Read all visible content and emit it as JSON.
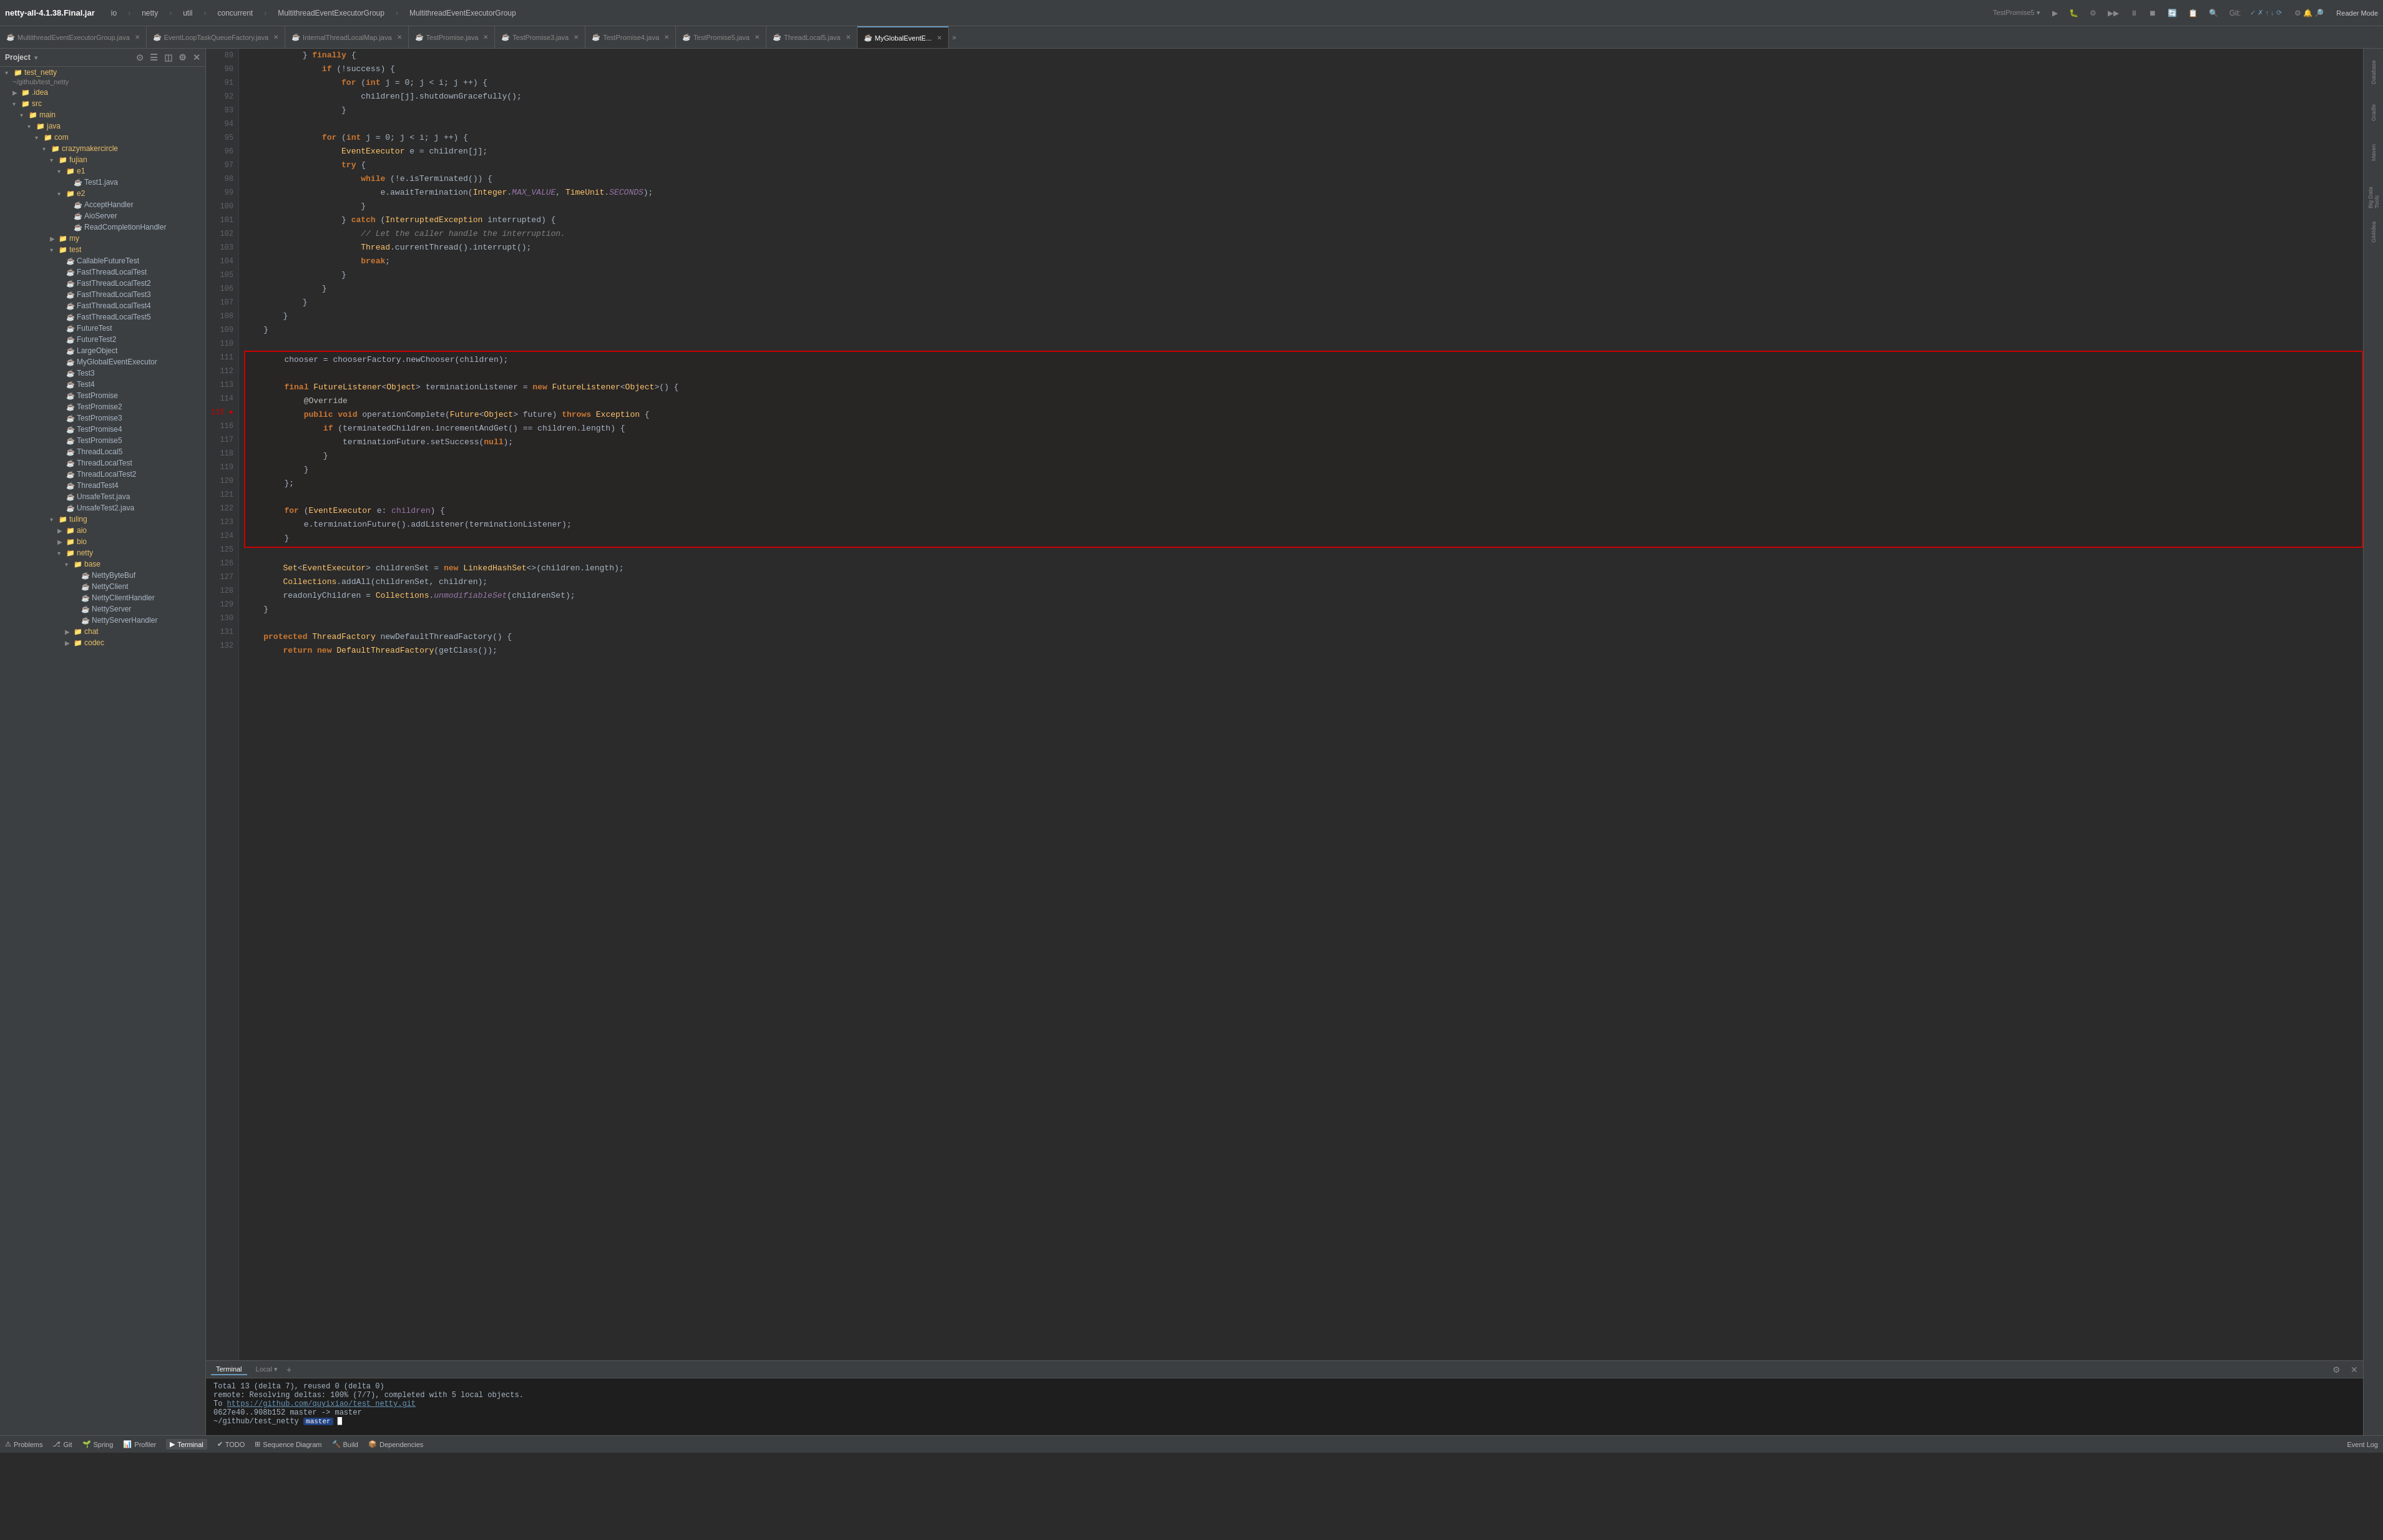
{
  "app": {
    "title": "netty-all-4.1.38.Final.jar",
    "menu_items": [
      "io",
      "netty",
      "util",
      "concurrent",
      "MultithreadEventExecutorGroup",
      "MultithreadEventExecutorGroup"
    ]
  },
  "tabs": [
    {
      "id": "tab1",
      "label": "MultithreadEventExecutorGroup.java",
      "active": false,
      "icon": "☕"
    },
    {
      "id": "tab2",
      "label": "EventLoopTaskQueueFactory.java",
      "active": false,
      "icon": "☕"
    },
    {
      "id": "tab3",
      "label": "InternalThreadLocalMap.java",
      "active": false,
      "icon": "☕"
    },
    {
      "id": "tab4",
      "label": "TestPromise.java",
      "active": false,
      "icon": "☕"
    },
    {
      "id": "tab5",
      "label": "TestPromise3.java",
      "active": false,
      "icon": "☕"
    },
    {
      "id": "tab6",
      "label": "TestPromise4.java",
      "active": false,
      "icon": "☕"
    },
    {
      "id": "tab7",
      "label": "TestPromise5.java",
      "active": false,
      "icon": "☕"
    },
    {
      "id": "tab8",
      "label": "ThreadLocal5.java",
      "active": false,
      "icon": "☕"
    },
    {
      "id": "tab9",
      "label": "MyGlobalEventE...",
      "active": true,
      "icon": "☕"
    }
  ],
  "sidebar": {
    "project_label": "Project",
    "root": {
      "label": "test_netty",
      "path": "~/github/test_netty",
      "items": [
        {
          "id": "idea",
          "label": ".idea",
          "type": "folder",
          "indent": 1
        },
        {
          "id": "src",
          "label": "src",
          "type": "folder",
          "indent": 1,
          "expanded": true
        },
        {
          "id": "main",
          "label": "main",
          "type": "folder",
          "indent": 2,
          "expanded": true
        },
        {
          "id": "java",
          "label": "java",
          "type": "folder",
          "indent": 3,
          "expanded": true
        },
        {
          "id": "com",
          "label": "com",
          "type": "folder",
          "indent": 4,
          "expanded": true
        },
        {
          "id": "crazymakercircle",
          "label": "crazymakercircle",
          "type": "folder",
          "indent": 5,
          "expanded": true
        },
        {
          "id": "fujian",
          "label": "fujian",
          "type": "folder",
          "indent": 6,
          "expanded": true
        },
        {
          "id": "e1",
          "label": "e1",
          "type": "folder",
          "indent": 7,
          "expanded": true
        },
        {
          "id": "Test1java",
          "label": "Test1.java",
          "type": "java",
          "indent": 8
        },
        {
          "id": "e2",
          "label": "e2",
          "type": "folder",
          "indent": 7,
          "expanded": true
        },
        {
          "id": "AcceptHandler",
          "label": "AcceptHandler",
          "type": "java",
          "indent": 8
        },
        {
          "id": "AioServer",
          "label": "AioServer",
          "type": "java",
          "indent": 8
        },
        {
          "id": "ReadCompletionHandler",
          "label": "ReadCompletionHandler",
          "type": "java",
          "indent": 8
        },
        {
          "id": "my",
          "label": "my",
          "type": "folder",
          "indent": 6,
          "expanded": false
        },
        {
          "id": "test",
          "label": "test",
          "type": "folder",
          "indent": 6,
          "expanded": true
        },
        {
          "id": "CallableFutureTest",
          "label": "CallableFutureTest",
          "type": "java",
          "indent": 7
        },
        {
          "id": "FastThreadLocalTest",
          "label": "FastThreadLocalTest",
          "type": "java",
          "indent": 7
        },
        {
          "id": "FastThreadLocalTest2",
          "label": "FastThreadLocalTest2",
          "type": "java",
          "indent": 7
        },
        {
          "id": "FastThreadLocalTest3",
          "label": "FastThreadLocalTest3",
          "type": "java",
          "indent": 7
        },
        {
          "id": "FastThreadLocalTest4",
          "label": "FastThreadLocalTest4",
          "type": "java",
          "indent": 7
        },
        {
          "id": "FastThreadLocalTest5",
          "label": "FastThreadLocalTest5",
          "type": "java",
          "indent": 7
        },
        {
          "id": "FutureTest",
          "label": "FutureTest",
          "type": "java",
          "indent": 7
        },
        {
          "id": "FutureTest2",
          "label": "FutureTest2",
          "type": "java",
          "indent": 7
        },
        {
          "id": "LargeObject",
          "label": "LargeObject",
          "type": "java",
          "indent": 7
        },
        {
          "id": "MyGlobalEventExecutor",
          "label": "MyGlobalEventExecutor",
          "type": "java",
          "indent": 7
        },
        {
          "id": "Test3",
          "label": "Test3",
          "type": "java",
          "indent": 7
        },
        {
          "id": "Test4",
          "label": "Test4",
          "type": "java",
          "indent": 7
        },
        {
          "id": "TestPromise",
          "label": "TestPromise",
          "type": "java",
          "indent": 7
        },
        {
          "id": "TestPromise2",
          "label": "TestPromise2",
          "type": "java",
          "indent": 7
        },
        {
          "id": "TestPromise3",
          "label": "TestPromise3",
          "type": "java",
          "indent": 7
        },
        {
          "id": "TestPromise4",
          "label": "TestPromise4",
          "type": "java",
          "indent": 7
        },
        {
          "id": "TestPromise5",
          "label": "TestPromise5",
          "type": "java",
          "indent": 7
        },
        {
          "id": "ThreadLocal5",
          "label": "ThreadLocal5",
          "type": "java",
          "indent": 7
        },
        {
          "id": "ThreadLocalTest",
          "label": "ThreadLocalTest",
          "type": "java",
          "indent": 7
        },
        {
          "id": "ThreadLocalTest2",
          "label": "ThreadLocalTest2",
          "type": "java",
          "indent": 7
        },
        {
          "id": "ThreadTest4",
          "label": "ThreadTest4",
          "type": "java",
          "indent": 7
        },
        {
          "id": "UnsafeTest",
          "label": "UnsafeTest.java",
          "type": "java",
          "indent": 7
        },
        {
          "id": "UnsafeTest2",
          "label": "UnsafeTest2.java",
          "type": "java",
          "indent": 7
        },
        {
          "id": "tuling",
          "label": "tuling",
          "type": "folder",
          "indent": 6,
          "expanded": true
        },
        {
          "id": "aio",
          "label": "aio",
          "type": "folder",
          "indent": 7
        },
        {
          "id": "bio",
          "label": "bio",
          "type": "folder",
          "indent": 7
        },
        {
          "id": "netty",
          "label": "netty",
          "type": "folder",
          "indent": 7,
          "expanded": true
        },
        {
          "id": "base",
          "label": "base",
          "type": "folder",
          "indent": 8,
          "expanded": true
        },
        {
          "id": "NettyByteBuf",
          "label": "NettyByteBuf",
          "type": "java",
          "indent": 9
        },
        {
          "id": "NettyClient",
          "label": "NettyClient",
          "type": "java",
          "indent": 9
        },
        {
          "id": "NettyClientHandler",
          "label": "NettyClientHandler",
          "type": "java",
          "indent": 9
        },
        {
          "id": "NettyServer",
          "label": "NettyServer",
          "type": "java",
          "indent": 9
        },
        {
          "id": "NettyServerHandler",
          "label": "NettyServerHandler",
          "type": "java",
          "indent": 9
        },
        {
          "id": "chat",
          "label": "chat",
          "type": "folder",
          "indent": 8
        },
        {
          "id": "codec",
          "label": "codec",
          "type": "folder",
          "indent": 8
        }
      ]
    }
  },
  "code": {
    "lines": [
      {
        "num": 89,
        "content": "            } <span class='kw'>finally</span> {",
        "highlighted": false
      },
      {
        "num": 90,
        "content": "                <span class='kw'>if</span> (!success) {",
        "highlighted": false
      },
      {
        "num": 91,
        "content": "                    <span class='kw'>for</span> (<span class='kw'>int</span> j = 0; j &lt; i; j ++) {",
        "highlighted": false
      },
      {
        "num": 92,
        "content": "                        children[j].shutdownGracefully();",
        "highlighted": false
      },
      {
        "num": 93,
        "content": "                    }",
        "highlighted": false
      },
      {
        "num": 94,
        "content": "",
        "highlighted": false
      },
      {
        "num": 95,
        "content": "                <span class='kw'>for</span> (<span class='kw'>int</span> j = 0; j &lt; i; j ++) {",
        "highlighted": false
      },
      {
        "num": 96,
        "content": "                    <span class='type'>EventExecutor</span> e = children[j];",
        "highlighted": false
      },
      {
        "num": 97,
        "content": "                    <span class='kw'>try</span> {",
        "highlighted": false
      },
      {
        "num": 98,
        "content": "                        <span class='kw'>while</span> (!e.isTerminated()) {",
        "highlighted": false
      },
      {
        "num": 99,
        "content": "                            e.awaitTermination(<span class='type'>Integer</span>.<span class='static-field'>MAX_VALUE</span>, <span class='type'>TimeUnit</span>.<span class='static-field'>SECONDS</span>);",
        "highlighted": false
      },
      {
        "num": 100,
        "content": "                        }",
        "highlighted": false
      },
      {
        "num": 101,
        "content": "                    } <span class='kw'>catch</span> (<span class='type'>InterruptedException</span> interrupted) {",
        "highlighted": false
      },
      {
        "num": 102,
        "content": "                        <span class='comment'>// Let the caller handle the interruption.</span>",
        "highlighted": false
      },
      {
        "num": 103,
        "content": "                        <span class='type'>Thread</span>.currentThread().interrupt();",
        "highlighted": false
      },
      {
        "num": 104,
        "content": "                        <span class='kw'>break</span>;",
        "highlighted": false
      },
      {
        "num": 105,
        "content": "                    }",
        "highlighted": false
      },
      {
        "num": 106,
        "content": "                }",
        "highlighted": false
      },
      {
        "num": 107,
        "content": "            }",
        "highlighted": false
      },
      {
        "num": 108,
        "content": "        }",
        "highlighted": false
      },
      {
        "num": 109,
        "content": "    }",
        "highlighted": false
      },
      {
        "num": 110,
        "content": "",
        "highlighted": false
      },
      {
        "num": 111,
        "content": "        chooser = chooserFactory.newChooser(children);",
        "highlighted": true
      },
      {
        "num": 112,
        "content": "",
        "highlighted": true
      },
      {
        "num": 113,
        "content": "        <span class='kw'>final</span> <span class='type'>FutureListener</span>&lt;<span class='type'>Object</span>&gt; terminationListener = <span class='kw'>new</span> <span class='type'>FutureListener</span>&lt;<span class='type'>Object</span>&gt;() {",
        "highlighted": true
      },
      {
        "num": 114,
        "content": "            <span class='annotation'>@Override</span>",
        "highlighted": true
      },
      {
        "num": 115,
        "content": "            <span class='kw'>public</span> <span class='kw'>void</span> operationComplete(<span class='type'>Future</span>&lt;<span class='type'>Object</span>&gt; future) <span class='kw'>throws</span> <span class='type'>Exception</span> {",
        "highlighted": true
      },
      {
        "num": 116,
        "content": "                <span class='kw'>if</span> (terminatedChildren.incrementAndGet() == children.length) {",
        "highlighted": true
      },
      {
        "num": 117,
        "content": "                    terminationFuture.setSuccess(<span class='kw'>null</span>);",
        "highlighted": true
      },
      {
        "num": 118,
        "content": "                }",
        "highlighted": true
      },
      {
        "num": 119,
        "content": "            }",
        "highlighted": true
      },
      {
        "num": 120,
        "content": "        };",
        "highlighted": true
      },
      {
        "num": 121,
        "content": "",
        "highlighted": true
      },
      {
        "num": 122,
        "content": "        <span class='kw'>for</span> (<span class='type'>EventExecutor</span> e: <span class='kw'>children</span>) {",
        "highlighted": true
      },
      {
        "num": 123,
        "content": "            e.terminationFuture().addListener(terminationListener);",
        "highlighted": true
      },
      {
        "num": 124,
        "content": "        }",
        "highlighted": true
      },
      {
        "num": 125,
        "content": "",
        "highlighted": false
      },
      {
        "num": 126,
        "content": "        <span class='type'>Set</span>&lt;<span class='type'>EventExecutor</span>&gt; childrenSet = <span class='kw'>new</span> <span class='type'>LinkedHashSet</span>&lt;&gt;(children.length);",
        "highlighted": false
      },
      {
        "num": 127,
        "content": "        <span class='type'>Collections</span>.addAll(childrenSet, children);",
        "highlighted": false
      },
      {
        "num": 128,
        "content": "        readonlyChildren = <span class='type'>Collections</span>.<span class='static-field'>unmodifiableSet</span>(childrenSet);",
        "highlighted": false
      },
      {
        "num": 129,
        "content": "    }",
        "highlighted": false
      },
      {
        "num": 130,
        "content": "",
        "highlighted": false
      },
      {
        "num": 131,
        "content": "    <span class='kw'>protected</span> <span class='type'>ThreadFactory</span> newDefaultThreadFactory() {",
        "highlighted": false
      },
      {
        "num": 132,
        "content": "        <span class='kw'>return</span> <span class='kw'>new</span> <span class='type'>DefaultThreadFactory</span>(getClass());",
        "highlighted": false
      }
    ]
  },
  "terminal": {
    "tab_label": "Terminal",
    "local_label": "Local",
    "lines": [
      "Total 13 (delta 7), reused 0 (delta 0)",
      "remote: Resolving deltas: 100% (7/7), completed with 5 local objects.",
      "To https://github.com/quyixiao/test_netty.git",
      "  0627e40..908b152  master -> master"
    ],
    "prompt_text": "~/github/test_netty",
    "branch": "master"
  },
  "status_bar": {
    "items": [
      "Problems",
      "Git",
      "Spring",
      "Profiler",
      "Terminal",
      "TODO",
      "Sequence Diagram",
      "Build",
      "Dependencies"
    ]
  },
  "right_tools": [
    "Database",
    "Gradle",
    "Maven",
    "Big Data Tools",
    "Git4Idea"
  ]
}
